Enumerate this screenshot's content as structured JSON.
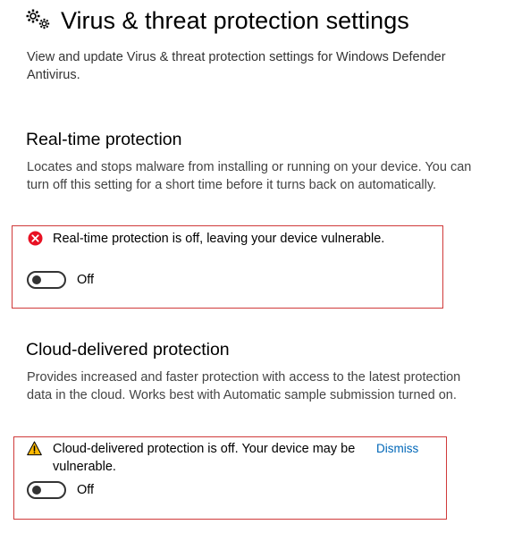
{
  "page": {
    "title": "Virus & threat protection settings",
    "description": "View and update Virus & threat protection settings for Windows Defender Antivirus.",
    "icon": "gear-icon"
  },
  "realtime": {
    "heading": "Real-time protection",
    "description": "Locates and stops malware from installing or running on your device. You can turn off this setting for a short time before it turns back on automatically.",
    "alert_icon": "error-icon",
    "alert_text": "Real-time protection is off, leaving your device vulnerable.",
    "toggle_state": "Off"
  },
  "cloud": {
    "heading": "Cloud-delivered protection",
    "description": "Provides increased and faster protection with access to the latest protection data in the cloud. Works best with Automatic sample submission turned on.",
    "alert_icon": "warning-icon",
    "alert_text": "Cloud-delivered protection is off. Your device may be vulnerable.",
    "dismiss_label": "Dismiss",
    "toggle_state": "Off"
  },
  "colors": {
    "error": "#e81123",
    "warning": "#ffb900",
    "highlight_border": "#d03a3a",
    "link": "#0067b8"
  }
}
